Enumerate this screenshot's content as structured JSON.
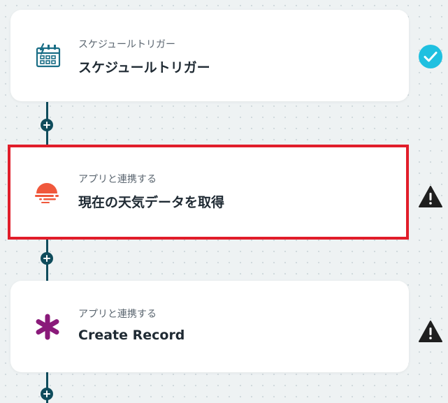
{
  "flow": {
    "steps": [
      {
        "subtitle": "スケジュールトリガー",
        "title": "スケジュールトリガー",
        "icon": "calendar-bolt-icon",
        "status": "check-circle-icon",
        "status_color": "#1fc0e0"
      },
      {
        "subtitle": "アプリと連携する",
        "title": "現在の天気データを取得",
        "icon": "sunset-weather-icon",
        "status": "warning-icon",
        "highlight_color": "#e11d2a"
      },
      {
        "subtitle": "アプリと連携する",
        "title": "Create Record",
        "icon": "asterisk-icon",
        "status": "warning-icon"
      }
    ],
    "add_button_icon": "plus-icon"
  },
  "colors": {
    "accent": "#0f4c5c",
    "brand_teal": "#1a6e86",
    "weather_orange": "#f0583c",
    "asterisk_purple": "#8a1a7a",
    "check_cyan": "#1fc0e0",
    "warning_dark": "#1f1f1f"
  }
}
